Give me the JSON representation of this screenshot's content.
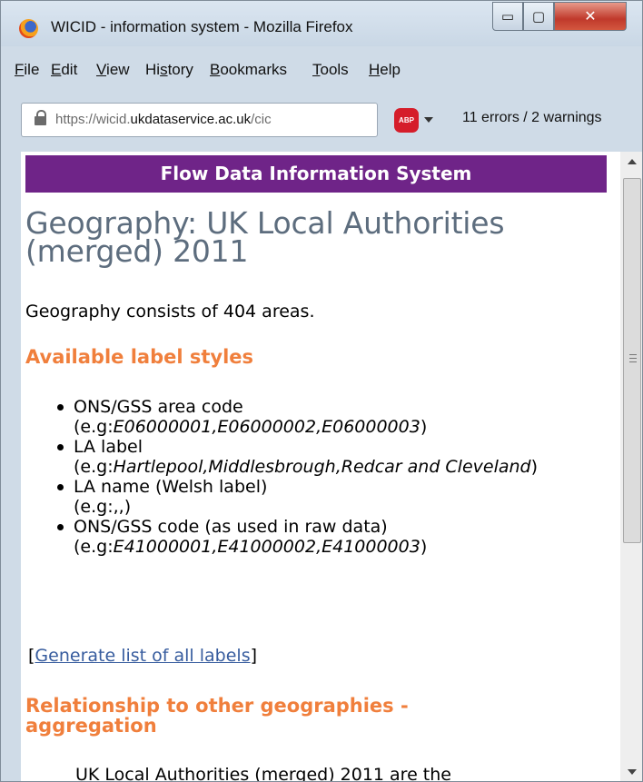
{
  "window": {
    "title": "WICID - information system - Mozilla Firefox",
    "controls": {
      "minimize": "▭",
      "maximize": "▢",
      "close": "✕"
    }
  },
  "menu": [
    {
      "accel": "F",
      "rest": "ile"
    },
    {
      "accel": "E",
      "rest": "dit"
    },
    {
      "accel": "V",
      "rest": "iew"
    },
    {
      "pre": "Hi",
      "accel": "s",
      "rest": "tory"
    },
    {
      "accel": "B",
      "rest": "ookmarks"
    },
    {
      "accel": "T",
      "rest": "ools"
    },
    {
      "accel": "H",
      "rest": "elp"
    }
  ],
  "address_bar": {
    "url_prefix": "https://wicid.",
    "url_domain": "ukdataservice.ac.uk",
    "url_suffix": "/cic",
    "abp_label": "ABP",
    "validator_status": "11 errors / 2 warnings"
  },
  "page": {
    "banner": "Flow Data Information System",
    "title": "Geography: UK Local Authorities (merged) 2011",
    "summary": "Geography consists of 404 areas.",
    "label_styles_heading": "Available label styles",
    "label_styles": [
      {
        "name": "ONS/GSS area code",
        "prefix": "(e.g:",
        "examples": "E06000001,E06000002,E06000003",
        "suffix": ")"
      },
      {
        "name": "LA label",
        "prefix": "(e.g:",
        "examples": "Hartlepool,Middlesbrough,Redcar and Cleveland",
        "suffix": ")"
      },
      {
        "name": "LA name (Welsh label)",
        "prefix": "(e.g:,,",
        "examples": "",
        "suffix": ")"
      },
      {
        "name": "ONS/GSS code (as used in raw data)",
        "prefix": "(e.g:",
        "examples": "E41000001,E41000002,E41000003",
        "suffix": ")"
      }
    ],
    "generate_open": "[",
    "generate_link": "Generate list of all labels",
    "generate_close": "]",
    "relationship_heading": "Relationship to other geographies - aggregation",
    "cutoff_line": "UK Local Authorities (merged) 2011 are the"
  },
  "colors": {
    "banner_bg": "#6f2488",
    "heading_orange": "#f07f3c",
    "title_grey": "#5d6d7e",
    "link_blue": "#375c9e"
  },
  "icons": [
    "firefox-logo-icon",
    "lock-icon",
    "adblock-icon",
    "dropdown-arrow-icon",
    "scroll-up-arrow-icon",
    "scroll-down-arrow-icon"
  ]
}
